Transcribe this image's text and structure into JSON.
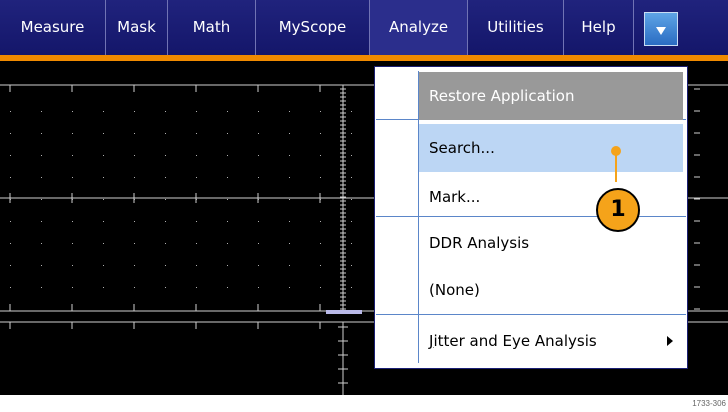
{
  "menubar": {
    "items": [
      "Measure",
      "Mask",
      "Math",
      "MyScope",
      "Analyze",
      "Utilities",
      "Help"
    ],
    "dropdown_icon": "down-triangle-icon"
  },
  "analyze_menu": {
    "items": [
      {
        "label": "Restore Application",
        "state": "disabled"
      },
      {
        "label": "Search...",
        "state": "highlighted"
      },
      {
        "label": "Mark..."
      },
      {
        "label": "DDR Analysis"
      },
      {
        "label": "(None)"
      },
      {
        "label": "Jitter and Eye Analysis",
        "mnemonic": "J",
        "rest": "itter and Eye Analysis",
        "submenu": true
      }
    ]
  },
  "callout": {
    "number": "1"
  },
  "figure_id": "1733-306",
  "colors": {
    "menubar": "#1a1d73",
    "accent_line": "#f08a00",
    "highlight": "#bcd6f4",
    "disabled_row": "#999999",
    "callout": "#f5a31a"
  }
}
